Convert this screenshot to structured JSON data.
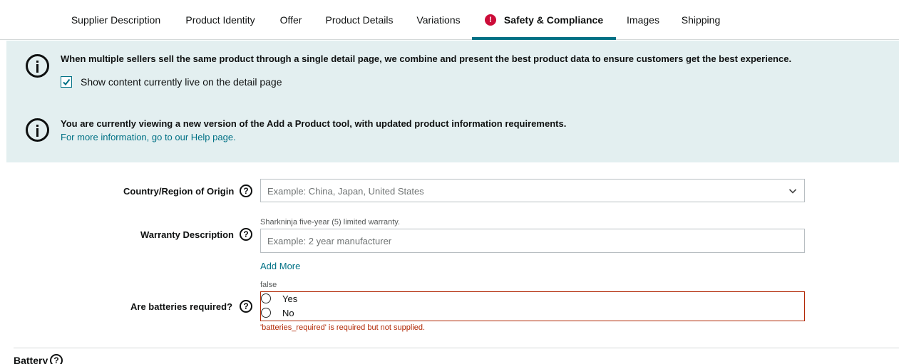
{
  "tabs": [
    {
      "label": "Supplier Description",
      "active": false,
      "error": false
    },
    {
      "label": "Product Identity",
      "active": false,
      "error": false
    },
    {
      "label": "Offer",
      "active": false,
      "error": false
    },
    {
      "label": "Product Details",
      "active": false,
      "error": false
    },
    {
      "label": "Variations",
      "active": false,
      "error": false
    },
    {
      "label": "Safety & Compliance",
      "active": true,
      "error": true
    },
    {
      "label": "Images",
      "active": false,
      "error": false
    },
    {
      "label": "Shipping",
      "active": false,
      "error": false
    }
  ],
  "banner": {
    "message_1": "When multiple sellers sell the same product through a single detail page, we combine and present the best product data to ensure customers get the best experience.",
    "checkbox_label": "Show content currently live on the detail page",
    "checkbox_checked": true,
    "message_2": "You are currently viewing a new version of the Add a Product tool, with updated product information requirements.",
    "help_link": "For more information, go to our Help page."
  },
  "form": {
    "country": {
      "label": "Country/Region of Origin",
      "placeholder": "Example: China, Japan, United States"
    },
    "warranty": {
      "label": "Warranty Description",
      "live_value": "Sharkninja five-year (5) limited warranty.",
      "placeholder": "Example: 2 year manufacturer",
      "add_more": "Add More"
    },
    "batteries": {
      "label": "Are batteries required?",
      "live_value": "false",
      "options": [
        "Yes",
        "No"
      ],
      "error": "'batteries_required' is required but not supplied."
    }
  },
  "section": {
    "title": "Battery"
  },
  "colors": {
    "accent": "#007185",
    "error": "#b12704",
    "banner_bg": "#e3eff0"
  }
}
